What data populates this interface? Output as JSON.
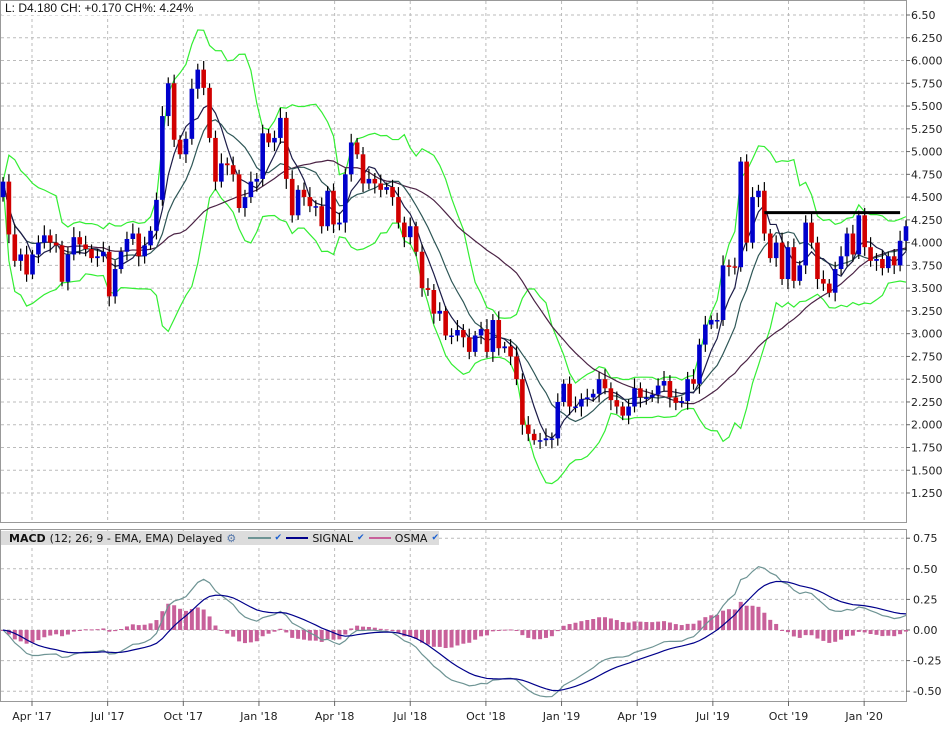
{
  "header": {
    "text": "L: D4.180 CH: +0.170 CH%: 4.24%"
  },
  "macd_legend": {
    "title": "MACD",
    "params": "(12; 26; 9 - EMA, EMA) Delayed",
    "signal_label": "SIGNAL",
    "osma_label": "OSMA",
    "check": "✔"
  },
  "colors": {
    "up": "#0000cc",
    "down": "#d10000",
    "bands": "#33ee33",
    "ma_short": "#1c1c48",
    "ma_mid": "#2e5656",
    "ma_long": "#4a2244",
    "macd": "#6e9494",
    "signal": "#00008b",
    "osma": "#c8609a"
  },
  "chart_data": [
    {
      "type": "candlestick",
      "title": "",
      "interval": "weekly",
      "y_ticks": [
        "6.50",
        "6.250",
        "6.000",
        "5.750",
        "5.500",
        "5.250",
        "5.000",
        "4.750",
        "4.500",
        "4.250",
        "4.000",
        "3.750",
        "3.500",
        "3.250",
        "3.000",
        "2.750",
        "2.500",
        "2.250",
        "2.000",
        "1.750",
        "1.500",
        "1.250"
      ],
      "ylim": [
        1.0,
        6.65
      ],
      "x_ticks": [
        "Apr '17",
        "Jul '17",
        "Oct '17",
        "Jan '18",
        "Apr '18",
        "Jul '18",
        "Oct '18",
        "Jan '19",
        "Apr '19",
        "Jul '19",
        "Oct '19",
        "Jan '20"
      ],
      "grid": true,
      "close": [
        4.67,
        4.09,
        3.8,
        3.87,
        3.65,
        3.87,
        4.0,
        4.08,
        4.0,
        3.97,
        3.57,
        3.87,
        4.06,
        3.98,
        3.93,
        3.83,
        3.85,
        3.9,
        3.41,
        3.71,
        3.9,
        4.04,
        4.1,
        3.85,
        3.97,
        4.13,
        4.47,
        5.39,
        5.75,
        5.13,
        4.97,
        5.14,
        5.69,
        5.9,
        5.7,
        5.15,
        4.67,
        4.87,
        4.85,
        4.75,
        4.38,
        4.5,
        4.67,
        4.7,
        5.2,
        5.1,
        5.15,
        5.37,
        4.7,
        4.3,
        4.58,
        4.5,
        4.4,
        4.4,
        4.18,
        4.57,
        4.2,
        4.22,
        4.75,
        5.1,
        4.97,
        4.65,
        4.7,
        4.65,
        4.58,
        4.61,
        4.5,
        4.22,
        4.06,
        4.18,
        3.9,
        3.5,
        3.48,
        3.22,
        3.25,
        2.98,
        2.98,
        3.04,
        2.96,
        2.8,
        2.98,
        3.05,
        2.8,
        3.15,
        2.84,
        2.86,
        2.75,
        2.5,
        2.0,
        1.9,
        1.83,
        1.83,
        1.85,
        1.85,
        2.25,
        2.45,
        2.2,
        2.2,
        2.28,
        2.3,
        2.34,
        2.5,
        2.4,
        2.27,
        2.2,
        2.1,
        2.2,
        2.4,
        2.3,
        2.3,
        2.33,
        2.43,
        2.48,
        2.3,
        2.24,
        2.26,
        2.5,
        2.45,
        2.88,
        3.1,
        3.15,
        3.15,
        3.75,
        3.74,
        3.73,
        4.89,
        4.0,
        4.5,
        4.57,
        4.1,
        3.83,
        4.0,
        3.6,
        3.95,
        3.58,
        3.75,
        4.22,
        4.0,
        3.6,
        3.55,
        3.45,
        3.71,
        3.85,
        4.1,
        3.87,
        4.3,
        3.95,
        3.8,
        3.82,
        3.72,
        3.85,
        3.75,
        4.02,
        4.18
      ],
      "first_open": 4.5,
      "indicators": {
        "bollinger": {
          "period": 10,
          "dev": 2
        },
        "ma_short": 5,
        "ma_mid": 10,
        "ma_long": 30
      },
      "resistance_level": 4.33,
      "resistance_from_index": 129
    },
    {
      "type": "macd",
      "params": [
        12,
        26,
        9
      ],
      "y_ticks": [
        "0.75",
        "0.50",
        "0.25",
        "0.00",
        "-0.25",
        "-0.50"
      ],
      "ylim": [
        -0.6,
        0.8
      ],
      "series": [
        "MACD",
        "SIGNAL",
        "OSMA"
      ]
    }
  ]
}
